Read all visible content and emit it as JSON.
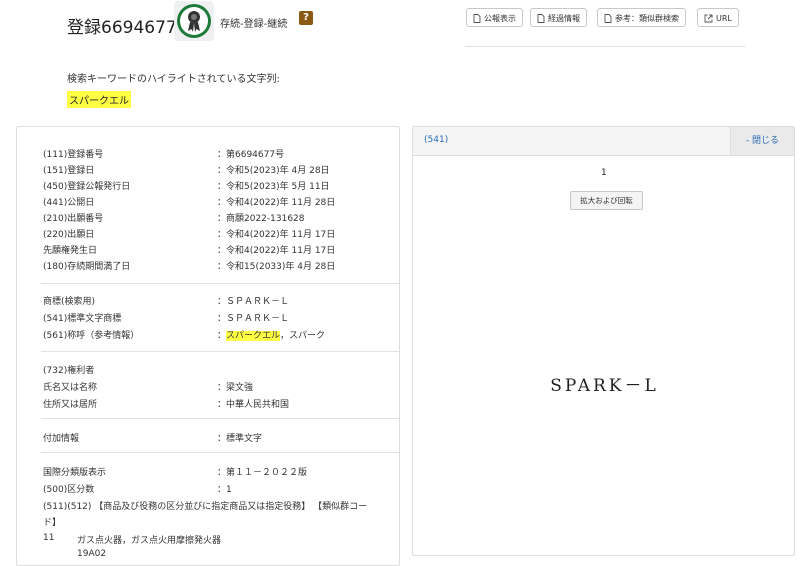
{
  "header": {
    "registration_title": "登録6694677",
    "status": "存続-登録-継続",
    "help_label": "?",
    "buttons": {
      "publication": "公報表示",
      "progress": "経過情報",
      "similar": "参考：類似群検索",
      "url": "URL"
    }
  },
  "keyword": {
    "label": "検索キーワードのハイライトされている文字列:",
    "term": "スパークエル"
  },
  "details": {
    "registration": [
      {
        "label": "(111)登録番号",
        "value": "：第6694677号"
      },
      {
        "label": "(151)登録日",
        "value": "：令和5(2023)年 4月 28日"
      },
      {
        "label": "(450)登録公報発行日",
        "value": "：令和5(2023)年 5月 11日"
      },
      {
        "label": "(441)公開日",
        "value": "：令和4(2022)年 11月 28日"
      },
      {
        "label": "(210)出願番号",
        "value": "：商願2022-131628"
      },
      {
        "label": "(220)出願日",
        "value": "：令和4(2022)年 11月 17日"
      },
      {
        "label": "先願権発生日",
        "value": "：令和4(2022)年 11月 17日"
      },
      {
        "label": "(180)存続期間満了日",
        "value": "：令和15(2033)年 4月 28日"
      }
    ],
    "mark": [
      {
        "label": "商標(検索用)",
        "value": "：ＳＰＡＲＫ－Ｌ"
      },
      {
        "label": "(541)標準文字商標",
        "value": "：ＳＰＡＲＫ－Ｌ"
      }
    ],
    "pronunciation": {
      "label": "(561)称呼（参考情報）",
      "prefix": "：",
      "highlight": "スパークエル",
      "rest": "，スパーク"
    },
    "owner": [
      {
        "label": "(732)権利者",
        "value": ""
      },
      {
        "label": "氏名又は名称",
        "value": "：梁文強"
      },
      {
        "label": "住所又は居所",
        "value": "：中華人民共和国"
      }
    ],
    "additional": {
      "label": "付加情報",
      "value": "：標準文字"
    },
    "classification": [
      {
        "label": "国際分類版表示",
        "value": "：第１１－２０２２版"
      },
      {
        "label": "(500)区分数",
        "value": "：1"
      }
    ],
    "goods_header_1": "(511)(512) 【商品及び役務の区分並びに指定商品又は指定役務】 【類似群コー",
    "goods_header_2": "ド】",
    "goods_class": "11",
    "goods_items": "ガス点火器，ガス点火用摩擦発火器",
    "goods_code": "19A02"
  },
  "viewer": {
    "id_label": "(541)",
    "close_label": "- 閉じる",
    "page_number": "1",
    "zoom_label": "拡大および回転",
    "mark_text": "SPARK－L"
  },
  "colors": {
    "highlight": "#ffff44",
    "link": "#2a6bb8",
    "help_badge": "#8a5a14",
    "badge_green": "#1f7a3a"
  }
}
